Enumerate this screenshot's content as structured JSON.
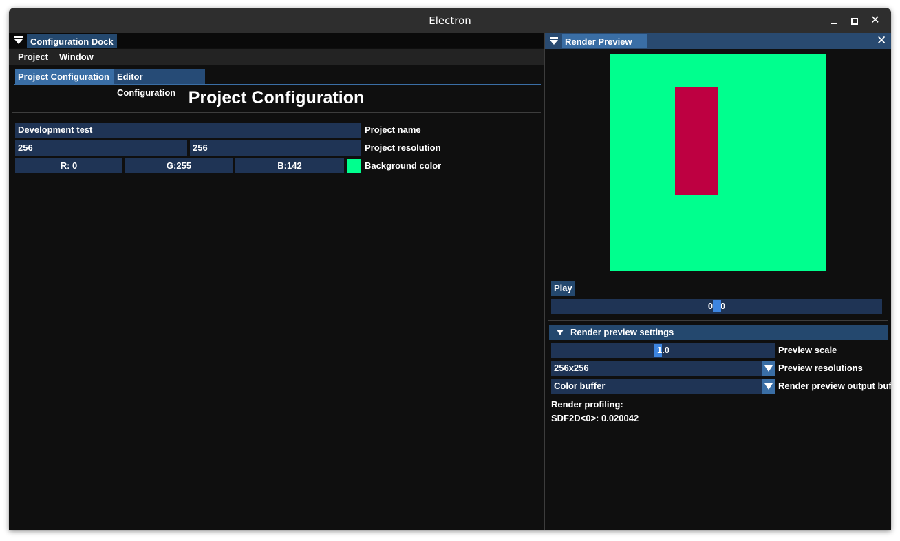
{
  "window": {
    "title": "Electron"
  },
  "config_dock": {
    "tab_label": "Configuration Dock",
    "menu": [
      "Project",
      "Window"
    ],
    "tabs": [
      "Project Configuration",
      "Editor Configuration"
    ],
    "active_tab": "Project Configuration",
    "section_title": "Project Configuration",
    "project_name": {
      "value": "Development test",
      "label": "Project name"
    },
    "project_resolution": {
      "width": "256",
      "height": "256",
      "label": "Project resolution"
    },
    "background_color": {
      "r": "R:  0",
      "g": "G:255",
      "b": "B:142",
      "swatch": "#00ff8e",
      "label": "Background color"
    }
  },
  "render_preview": {
    "tab_label": "Render Preview",
    "canvas_color": "#00ff8e",
    "shape_color": "#be0041",
    "play_label": "Play",
    "time_slider": {
      "value": "0.50",
      "fraction": 0.5
    },
    "settings": {
      "header": "Render preview settings",
      "preview_scale": {
        "value": "1.0",
        "label": "Preview scale"
      },
      "preview_resolution": {
        "value": "256x256",
        "label": "Preview resolutions"
      },
      "output_buffer": {
        "value": "Color buffer",
        "label": "Render preview output buf"
      }
    },
    "profiling": {
      "title": "Render profiling:",
      "entry": "SDF2D<0>: 0.020042"
    }
  },
  "colors": {
    "accent": "#3a6ea5",
    "field_bg": "#1f3455",
    "panel_bg": "#0f0f0f"
  }
}
